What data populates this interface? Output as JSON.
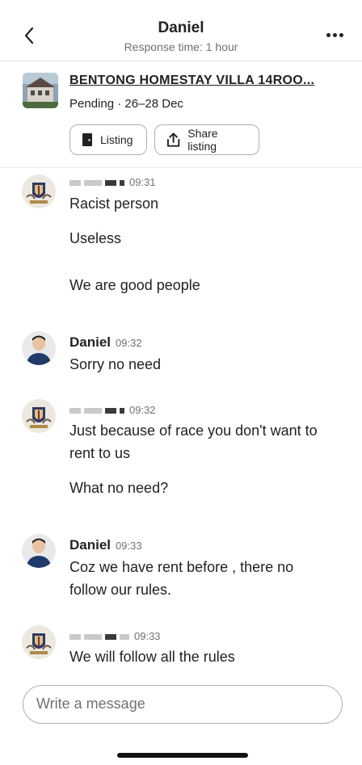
{
  "header": {
    "title": "Daniel",
    "subtitle": "Response time: 1 hour"
  },
  "listing": {
    "title": "BENTONG HOMESTAY VILLA 14ROO...",
    "status": "Pending · 26–28 Dec",
    "listing_button": "Listing",
    "share_button": "Share listing"
  },
  "messages": [
    {
      "sender": "",
      "time": "09:31",
      "lines": [
        "Racist person",
        "Useless",
        "We are good people"
      ]
    },
    {
      "sender": "Daniel",
      "time": "09:32",
      "lines": [
        "Sorry no need"
      ]
    },
    {
      "sender": "",
      "time": "09:32",
      "lines": [
        "Just because of race you don't want to",
        "rent to us",
        "What no need?"
      ]
    },
    {
      "sender": "Daniel",
      "time": "09:33",
      "lines": [
        "Coz we have rent before , there no",
        "follow our rules."
      ]
    },
    {
      "sender": "",
      "time": "09:33",
      "lines": [
        "We will follow all the rules"
      ]
    }
  ],
  "composer": {
    "placeholder": "Write a message"
  },
  "icons": {
    "back": "chevron-left-icon",
    "more": "more-horizontal-icon",
    "listing": "door-icon",
    "share": "share-upload-icon"
  }
}
